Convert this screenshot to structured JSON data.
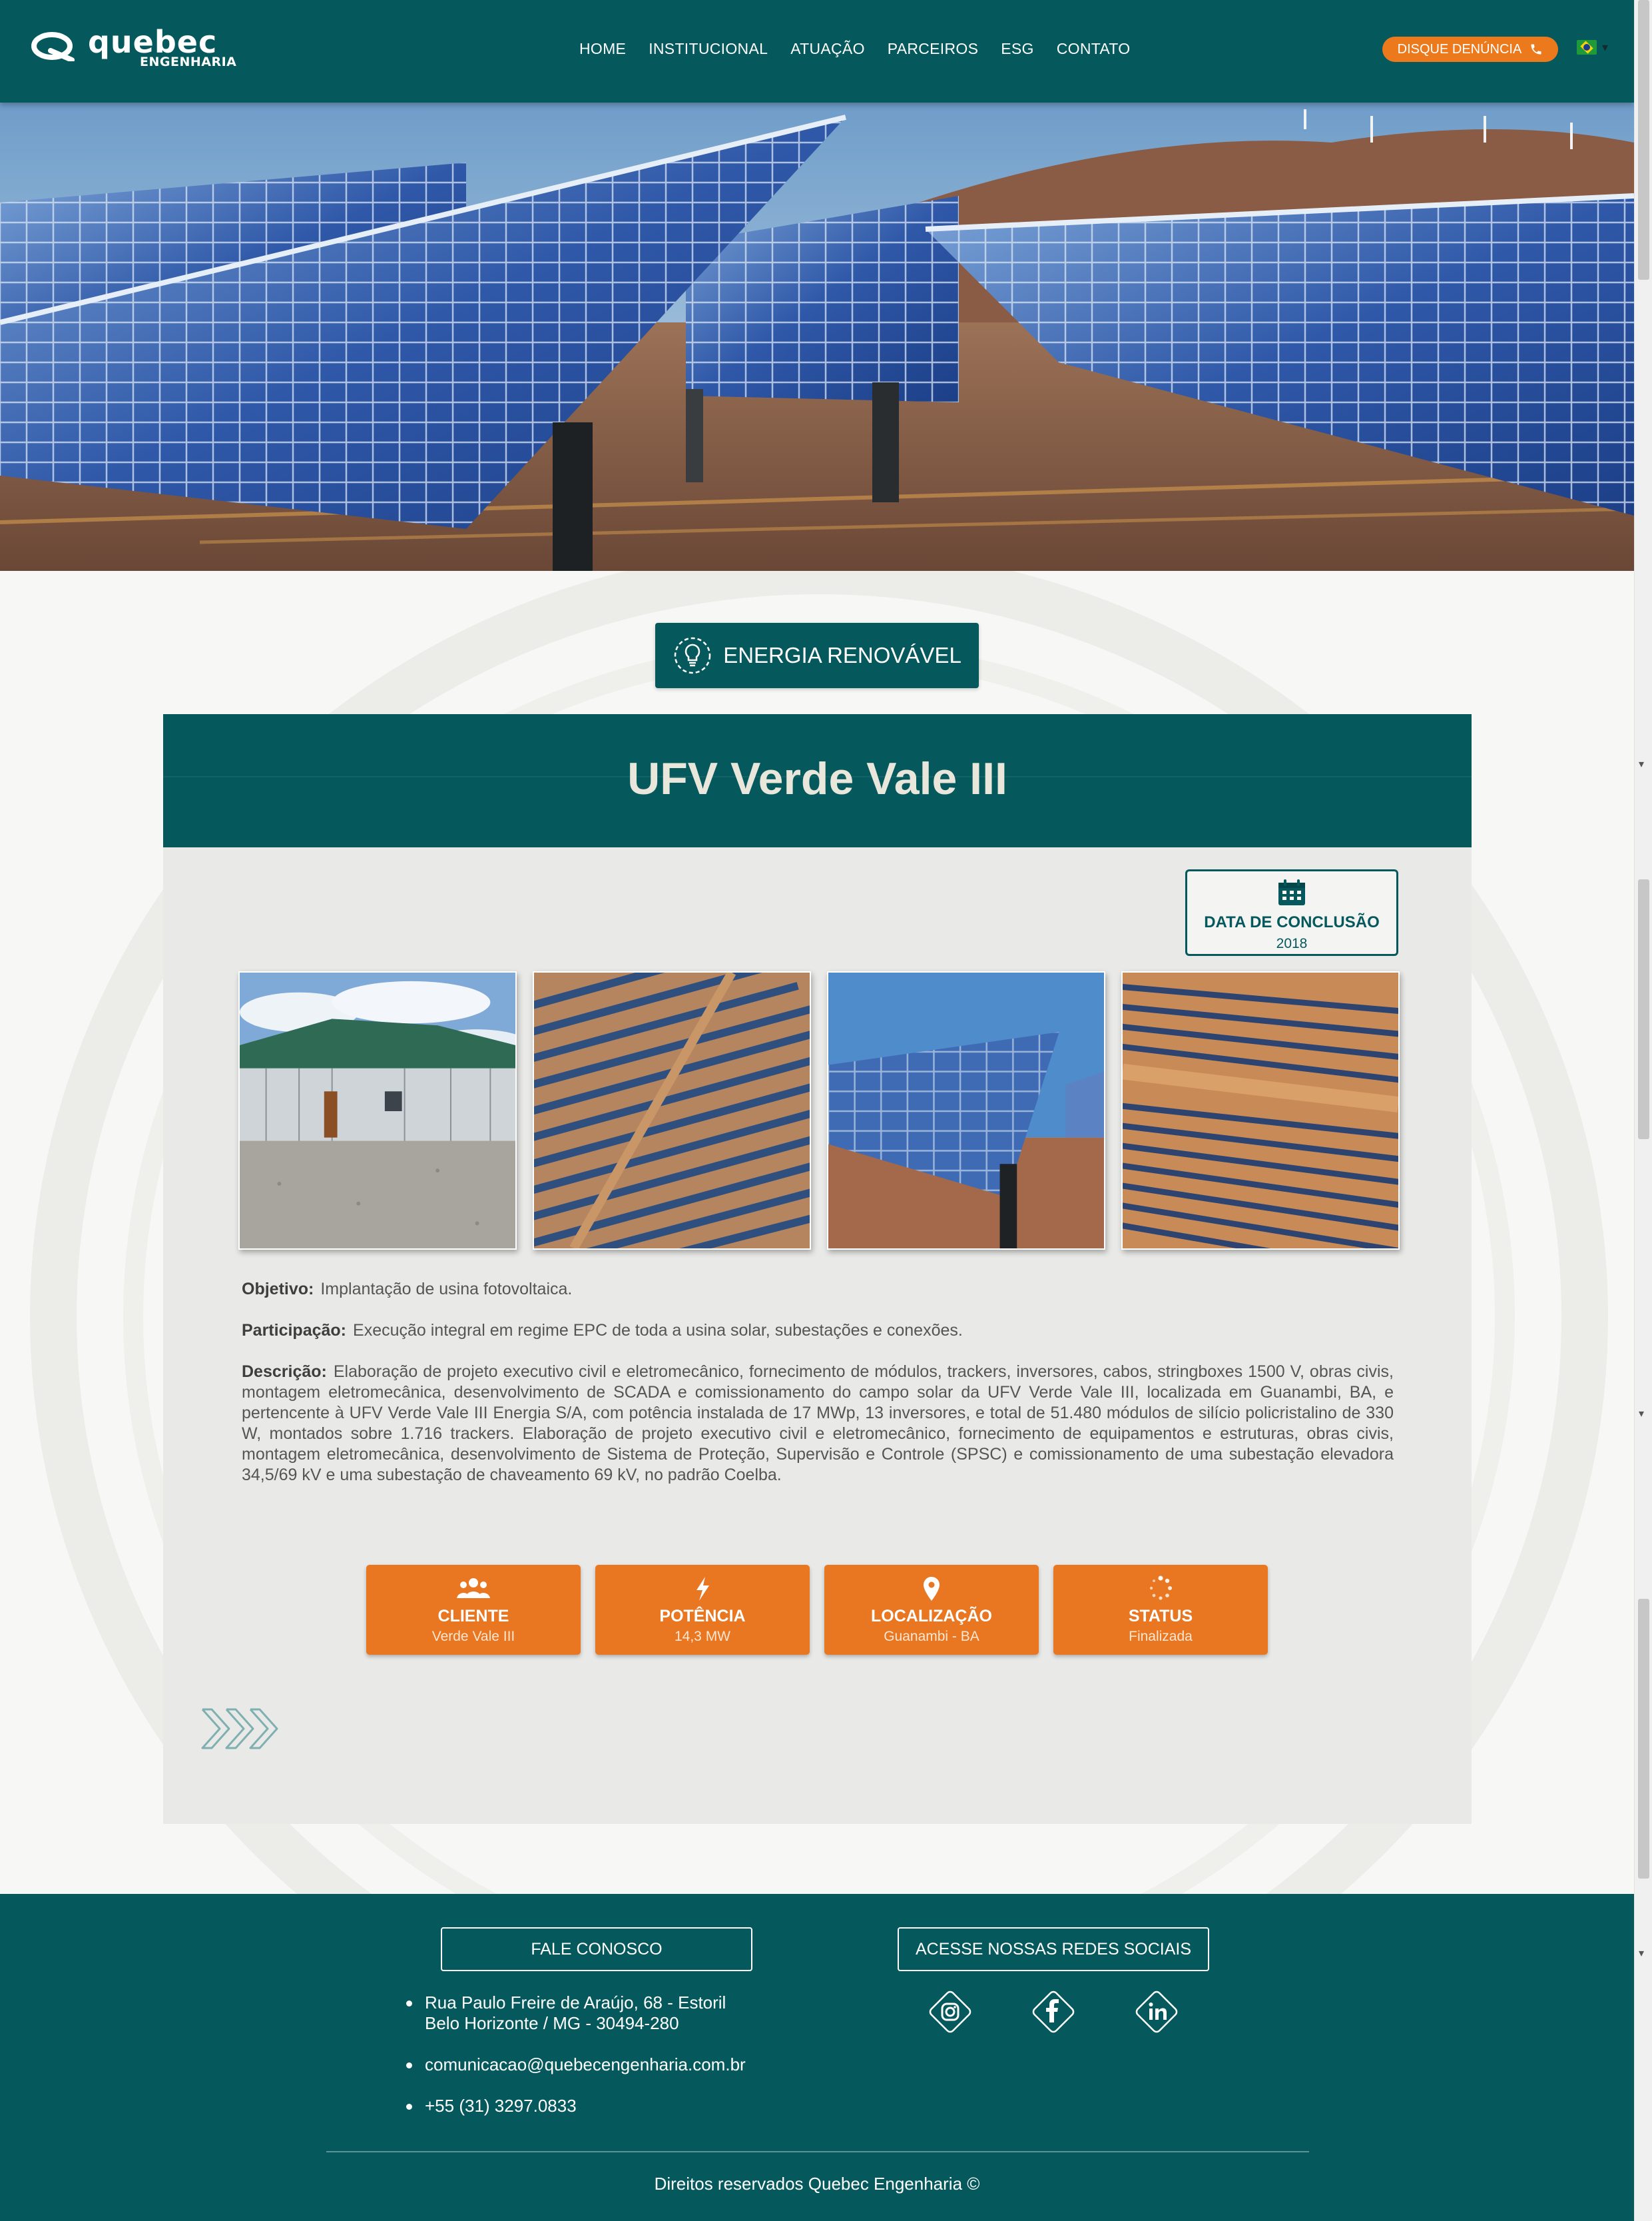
{
  "brand": {
    "name": "quebec",
    "subtitle": "ENGENHARIA",
    "primary_color": "#05595d",
    "accent_color": "#ec7a1c"
  },
  "header": {
    "nav": [
      "HOME",
      "INSTITUCIONAL",
      "ATUAÇÃO",
      "PARCEIROS",
      "ESG",
      "CONTATO"
    ],
    "denuncia_label": "DISQUE DENÚNCIA",
    "language_flag": "brazil-flag-icon"
  },
  "category": {
    "label": "ENERGIA RENOVÁVEL",
    "icon": "lightbulb-icon"
  },
  "project": {
    "title": "UFV Verde Vale III",
    "completion": {
      "label": "DATA DE CONCLUSÃO",
      "value": "2018",
      "icon": "calendar-icon"
    },
    "photos": [
      "substation-building-photo",
      "aerial-solar-rows-photo",
      "solar-tracker-closeup-photo",
      "aerial-solar-field-photo"
    ],
    "objetivo": {
      "label": "Objetivo:",
      "text": "Implantação de usina fotovoltaica."
    },
    "participacao": {
      "label": "Participação:",
      "text": "Execução integral em regime EPC de toda a usina solar, subestações e conexões."
    },
    "descricao": {
      "label": "Descrição:",
      "text": "Elaboração de projeto executivo civil e eletromecânico, fornecimento de módulos, trackers, inversores, cabos, stringboxes 1500 V, obras civis, montagem eletromecânica, desenvolvimento de SCADA e comissionamento do campo solar da UFV Verde Vale III, localizada em Guanambi, BA, e pertencente à UFV Verde Vale III Energia S/A, com potência instalada de 17 MWp, 13 inversores, e total de 51.480 módulos de silício policristalino de 330 W, montados sobre 1.716 trackers. Elaboração de projeto executivo civil e eletromecânico, fornecimento de equipamentos e estruturas, obras civis, montagem eletromecânica, desenvolvimento de Sistema de Proteção, Supervisão e Controle (SPSC) e comissionamento de uma subestação elevadora 34,5/69 kV e uma subestação de chaveamento 69 kV, no padrão Coelba."
    },
    "info": [
      {
        "title": "CLIENTE",
        "value": "Verde Vale III",
        "icon": "users-icon"
      },
      {
        "title": "POTÊNCIA",
        "value": "14,3 MW",
        "icon": "lightning-icon"
      },
      {
        "title": "LOCALIZAÇÃO",
        "value": "Guanambi - BA",
        "icon": "map-pin-icon"
      },
      {
        "title": "STATUS",
        "value": "Finalizada",
        "icon": "spinner-icon"
      }
    ]
  },
  "footer": {
    "contact_button": "FALE CONOSCO",
    "social_button": "ACESSE NOSSAS REDES SOCIAIS",
    "address_line1": "Rua Paulo Freire de Araújo, 68 - Estoril",
    "address_line2": "Belo Horizonte / MG - 30494-280",
    "email": "comunicacao@quebecengenharia.com.br",
    "phone": "+55 (31) 3297.0833",
    "social": [
      "instagram-icon",
      "facebook-icon",
      "linkedin-icon"
    ],
    "copyright": "Direitos reservados Quebec Engenharia ©"
  }
}
